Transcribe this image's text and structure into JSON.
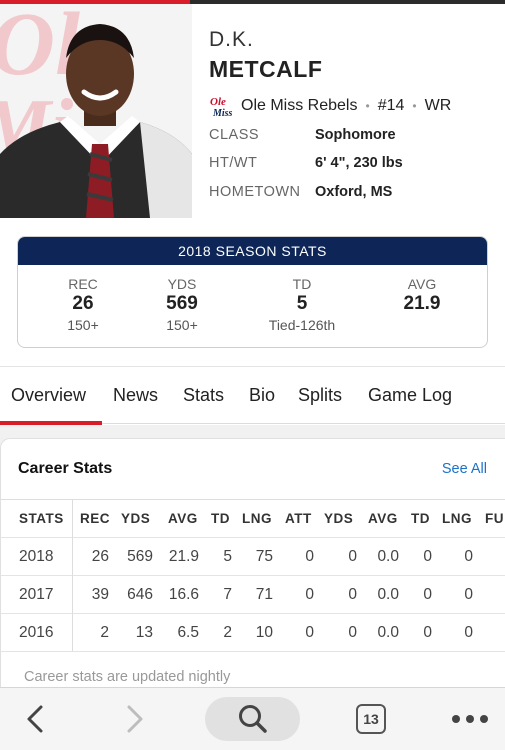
{
  "player": {
    "first_name": "D.K.",
    "last_name": "METCALF",
    "team": "Ole Miss Rebels",
    "number": "#14",
    "position": "WR",
    "separator": "•",
    "info": [
      {
        "label": "CLASS",
        "value": "Sophomore"
      },
      {
        "label": "HT/WT",
        "value": "6' 4\", 230 lbs"
      },
      {
        "label": "HOMETOWN",
        "value": "Oxford, MS"
      }
    ]
  },
  "season_stats": {
    "title": "2018 SEASON STATS",
    "columns": [
      {
        "label": "REC",
        "value": "26",
        "sub": "150+"
      },
      {
        "label": "YDS",
        "value": "569",
        "sub": "150+"
      },
      {
        "label": "TD",
        "value": "5",
        "sub": "Tied-126th"
      },
      {
        "label": "AVG",
        "value": "21.9",
        "sub": ""
      }
    ]
  },
  "tabs": [
    "Overview",
    "News",
    "Stats",
    "Bio",
    "Splits",
    "Game Log"
  ],
  "career": {
    "title": "Career Stats",
    "see_all": "See All",
    "headers": [
      "STATS",
      "REC",
      "YDS",
      "AVG",
      "TD",
      "LNG",
      "ATT",
      "YDS",
      "AVG",
      "TD",
      "LNG",
      "FU"
    ],
    "rows": [
      [
        "2018",
        "26",
        "569",
        "21.9",
        "5",
        "75",
        "0",
        "0",
        "0.0",
        "0",
        "0"
      ],
      [
        "2017",
        "39",
        "646",
        "16.6",
        "7",
        "71",
        "0",
        "0",
        "0.0",
        "0",
        "0"
      ],
      [
        "2016",
        "2",
        "13",
        "6.5",
        "2",
        "10",
        "0",
        "0",
        "0.0",
        "0",
        "0"
      ]
    ],
    "footnote": "Career stats are updated nightly"
  },
  "toolbar": {
    "tab_count": "13",
    "icons": [
      "back-icon",
      "forward-icon",
      "search-icon",
      "tabs-icon",
      "more-icon"
    ]
  },
  "colors": {
    "accent_red": "#d91c2a",
    "navy": "#0d2657",
    "link_blue": "#1a73c9"
  }
}
